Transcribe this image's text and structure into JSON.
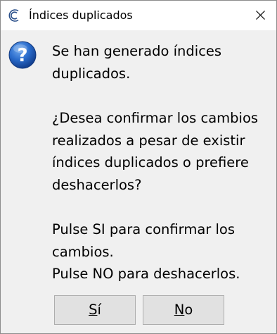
{
  "window": {
    "title": "Índices duplicados",
    "app_icon": "app-c-icon",
    "close_icon": "close-icon"
  },
  "dialog": {
    "icon": "question-icon",
    "accent_color": "#1f5fbf",
    "paragraphs": [
      "Se han generado índices duplicados.",
      "¿Desea confirmar los cambios realizados a pesar de existir índices duplicados o prefiere deshacerlos?",
      "Pulse SI para confirmar los cambios.",
      "Pulse NO para deshacerlos."
    ]
  },
  "buttons": {
    "yes": {
      "mnemonic": "S",
      "rest": "í"
    },
    "no": {
      "mnemonic": "N",
      "rest": "o"
    }
  }
}
